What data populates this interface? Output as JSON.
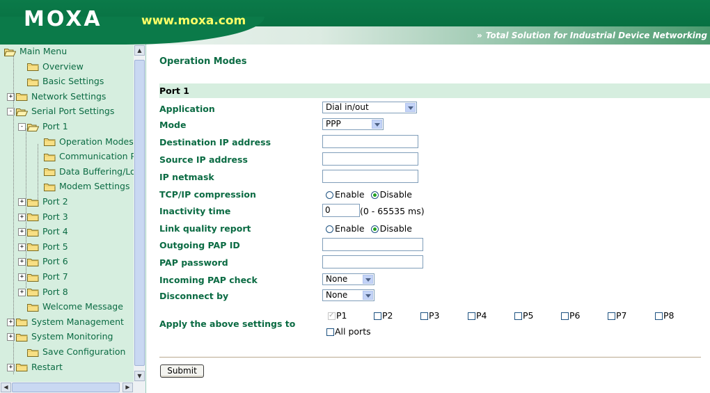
{
  "header": {
    "logo_text": "MOXA",
    "url": "www.moxa.com",
    "tagline": "Total Solution for Industrial Device Networking",
    "tagline_arrows": "»"
  },
  "sidebar": {
    "items": [
      {
        "label": "Main Menu",
        "expander": ""
      },
      {
        "label": "Overview",
        "expander": ""
      },
      {
        "label": "Basic Settings",
        "expander": ""
      },
      {
        "label": "Network Settings",
        "expander": "+"
      },
      {
        "label": "Serial Port Settings",
        "expander": "−"
      },
      {
        "label": "Port 1",
        "expander": "−"
      },
      {
        "label": "Operation Modes",
        "expander": ""
      },
      {
        "label": "Communication P.",
        "expander": ""
      },
      {
        "label": "Data Buffering/Lo",
        "expander": ""
      },
      {
        "label": "Modem Settings",
        "expander": ""
      },
      {
        "label": "Port 2",
        "expander": "+"
      },
      {
        "label": "Port 3",
        "expander": "+"
      },
      {
        "label": "Port 4",
        "expander": "+"
      },
      {
        "label": "Port 5",
        "expander": "+"
      },
      {
        "label": "Port 6",
        "expander": "+"
      },
      {
        "label": "Port 7",
        "expander": "+"
      },
      {
        "label": "Port 8",
        "expander": "+"
      },
      {
        "label": "Welcome Message",
        "expander": ""
      },
      {
        "label": "System Management",
        "expander": "+"
      },
      {
        "label": "System Monitoring",
        "expander": "+"
      },
      {
        "label": "Save Configuration",
        "expander": ""
      },
      {
        "label": "Restart",
        "expander": "+"
      }
    ]
  },
  "main": {
    "title": "Operation Modes",
    "section": "Port 1",
    "fields": {
      "application": {
        "label": "Application",
        "value": "Dial in/out"
      },
      "mode": {
        "label": "Mode",
        "value": "PPP"
      },
      "dest_ip": {
        "label": "Destination IP address",
        "value": ""
      },
      "src_ip": {
        "label": "Source IP address",
        "value": ""
      },
      "netmask": {
        "label": "IP netmask",
        "value": ""
      },
      "tcp_compression": {
        "label": "TCP/IP compression",
        "enable": "Enable",
        "disable": "Disable",
        "selected": "Disable"
      },
      "inactivity": {
        "label": "Inactivity time",
        "value": "0",
        "hint": "(0 - 65535 ms)"
      },
      "link_quality": {
        "label": "Link quality report",
        "enable": "Enable",
        "disable": "Disable",
        "selected": "Disable"
      },
      "pap_id": {
        "label": "Outgoing PAP ID",
        "value": ""
      },
      "pap_password": {
        "label": "PAP password",
        "value": ""
      },
      "pap_check": {
        "label": "Incoming PAP check",
        "value": "None"
      },
      "disconnect": {
        "label": "Disconnect by",
        "value": "None"
      }
    },
    "apply": {
      "label": "Apply the above settings to",
      "ports": [
        "P1",
        "P2",
        "P3",
        "P4",
        "P5",
        "P6",
        "P7",
        "P8"
      ],
      "checked_ports": [
        "P1"
      ],
      "all_ports": "All ports"
    },
    "submit_label": "Submit"
  },
  "colors": {
    "brand_green": "#0b7a49",
    "label_green": "#0b6b43",
    "sidebar_bg": "#d6eedf",
    "url_yellow": "#ffff66"
  }
}
